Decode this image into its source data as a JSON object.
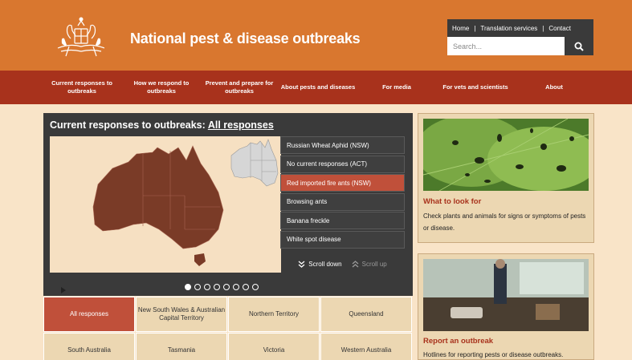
{
  "header": {
    "title": "National pest & disease outbreaks",
    "logo": "coat-of-arms",
    "utility_links": [
      "Home",
      "Translation services",
      "Contact"
    ],
    "search": {
      "placeholder": "Search..."
    }
  },
  "nav": {
    "items": [
      {
        "label": "Current responses to outbreaks"
      },
      {
        "label": "How we respond to outbreaks"
      },
      {
        "label": "Prevent and prepare for outbreaks"
      },
      {
        "label": "About pests and diseases"
      },
      {
        "label": "For media"
      },
      {
        "label": "For vets and scientists"
      },
      {
        "label": "About"
      }
    ]
  },
  "map_panel": {
    "heading": "Current responses to outbreaks:",
    "heading_link": "All responses",
    "outbreaks": [
      {
        "label": "Russian Wheat Aphid (NSW)",
        "active": false
      },
      {
        "label": "No current responses (ACT)",
        "active": false
      },
      {
        "label": "Red imported fire ants (NSW)",
        "active": true
      },
      {
        "label": "Browsing ants",
        "active": false
      },
      {
        "label": "Banana freckle",
        "active": false
      },
      {
        "label": "White spot disease",
        "active": false
      }
    ],
    "scroll_down": "Scroll down",
    "scroll_up": "Scroll up",
    "carousel_dots": 8,
    "active_dot": 0
  },
  "regions": [
    {
      "label": "All responses",
      "active": true
    },
    {
      "label": "New South Wales & Australian Capital Territory",
      "active": false
    },
    {
      "label": "Northern Territory",
      "active": false
    },
    {
      "label": "Queensland",
      "active": false
    },
    {
      "label": "South Australia",
      "active": false
    },
    {
      "label": "Tasmania",
      "active": false
    },
    {
      "label": "Victoria",
      "active": false
    },
    {
      "label": "Western Australia",
      "active": false
    }
  ],
  "cards": [
    {
      "title": "What to look for",
      "text": "Check plants and animals for signs or symptoms of pests or disease."
    },
    {
      "title": "Report an outbreak",
      "text": "Hotlines for reporting pests or disease outbreaks."
    }
  ],
  "colors": {
    "header_bg": "#d9772f",
    "nav_bg": "#a8321c",
    "page_bg": "#f9e4c8",
    "panel_dark": "#3a3a3a",
    "accent_red": "#c0503a",
    "card_bg": "#ecd7b2",
    "map_land": "#7a3b27"
  }
}
